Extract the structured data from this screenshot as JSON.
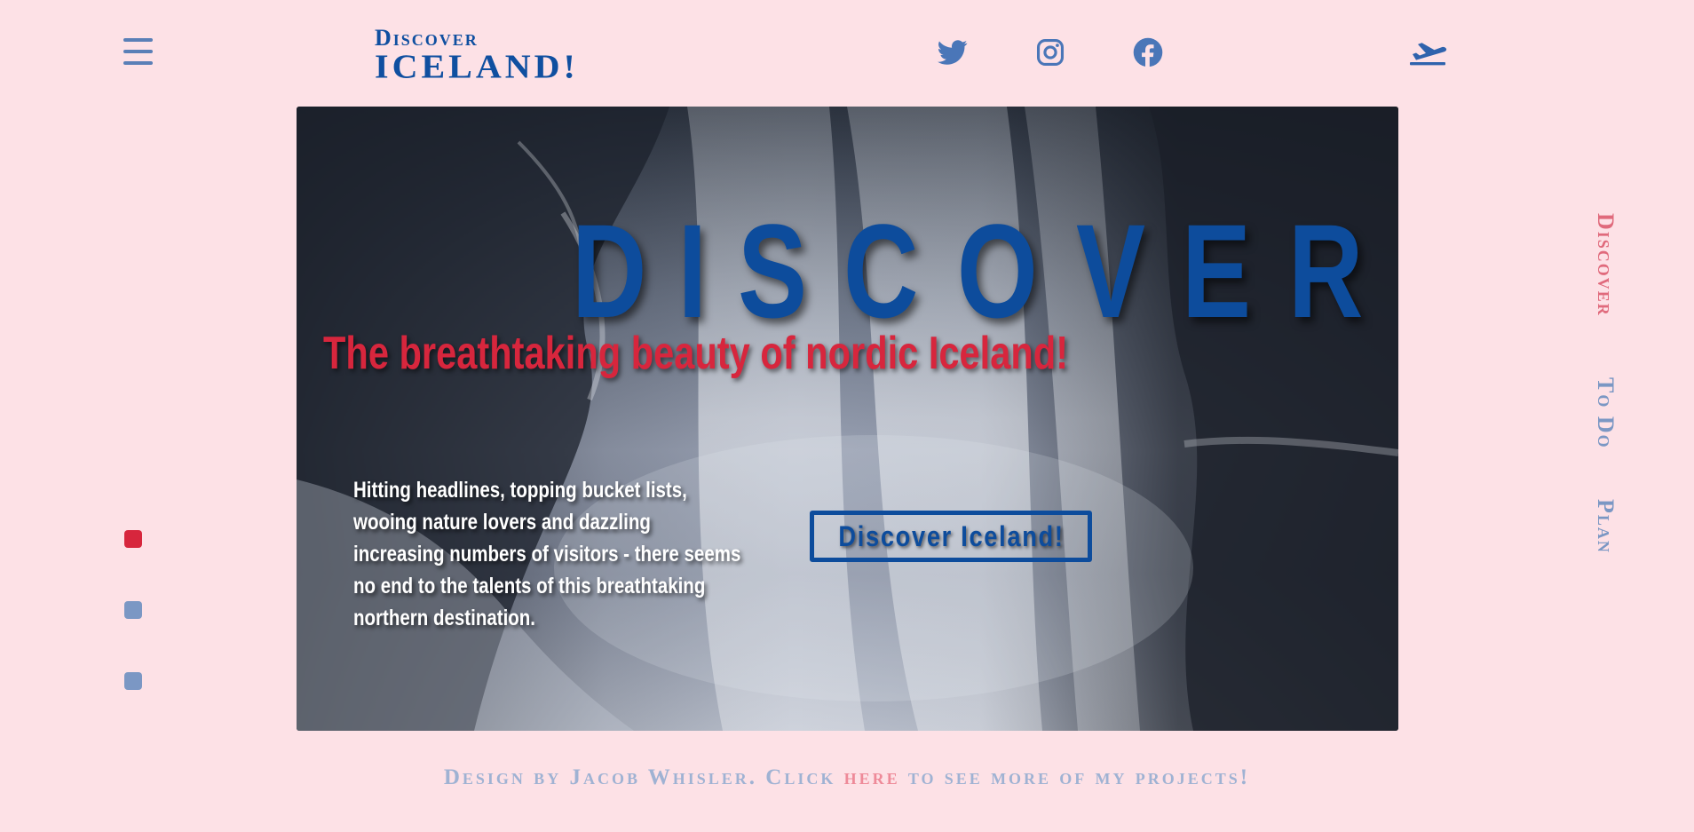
{
  "header": {
    "logo_top": "Discover",
    "logo_bottom": "ICELAND!",
    "menu_icon": "hamburger-menu-icon",
    "social_icons": [
      "twitter-icon",
      "instagram-icon",
      "facebook-icon"
    ],
    "travel_icon": "airplane-takeoff-icon"
  },
  "side_nav": {
    "dots": [
      {
        "state": "active"
      },
      {
        "state": "inactive"
      },
      {
        "state": "inactive"
      }
    ],
    "items": [
      {
        "label": "Discover",
        "state": "active"
      },
      {
        "label": "To Do",
        "state": "inactive"
      },
      {
        "label": "Plan",
        "state": "inactive"
      }
    ]
  },
  "hero": {
    "letters": [
      "D",
      "I",
      "S",
      "C",
      "O",
      "V",
      "E",
      "R"
    ],
    "tagline": "The breathtaking beauty of nordic Iceland!",
    "copy": "Hitting headlines, topping bucket lists, wooing nature lovers and dazzling increasing numbers of visitors - there seems no end to the talents of this breathtaking northern destination.",
    "button_label": "Discover Iceland!"
  },
  "footer": {
    "prefix": "Design by Jacob Whisler. Click",
    "link": "here",
    "suffix": "to see more of my projects!"
  },
  "colors": {
    "background": "#fde1e6",
    "brand_blue": "#0d4c9c",
    "muted_blue": "#7b97c4",
    "accent_red": "#d7263d",
    "accent_pink": "#e06a7c"
  }
}
